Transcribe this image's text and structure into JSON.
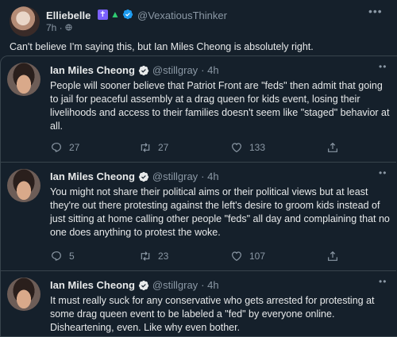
{
  "outer": {
    "name": "Elliebelle",
    "handle": "@VexatiousThinker",
    "time": "7h · ",
    "text": "Can't believe I'm saying this, but Ian Miles Cheong is absolutely right.",
    "badge_cross": "✝",
    "badge_tree": "▲"
  },
  "tweets": [
    {
      "name": "Ian Miles Cheong",
      "handle": "@stillgray",
      "time": "· 4h",
      "text": "People will sooner believe that Patriot Front are \"feds\" then admit that going to jail for peaceful assembly at a drag queen for kids event, losing their livelihoods and access to their families doesn't seem like \"staged\" behavior at all.",
      "replies": "27",
      "retweets": "27",
      "likes": "133"
    },
    {
      "name": "Ian Miles Cheong",
      "handle": "@stillgray",
      "time": "· 4h",
      "text": "You might not share their political aims or their political views but at least they're out there protesting against the left's desire to groom kids instead of just sitting at home calling other people \"feds\" all day and complaining that no one does anything to protest the woke.",
      "replies": "5",
      "retweets": "23",
      "likes": "107"
    },
    {
      "name": "Ian Miles Cheong",
      "handle": "@stillgray",
      "time": "· 4h",
      "text": "It must really suck for any conservative who gets arrested for protesting at some drag queen event to be labeled a \"fed\" by everyone online. Disheartening, even. Like why even bother."
    }
  ],
  "colors": {
    "background": "#15202b",
    "text": "#e7e9ea",
    "muted": "#8b98a5",
    "verified": "#1d9bf0",
    "border": "#38444d"
  },
  "icons": [
    "reply-icon",
    "retweet-icon",
    "like-icon",
    "share-icon",
    "verified-icon",
    "more-icon"
  ]
}
